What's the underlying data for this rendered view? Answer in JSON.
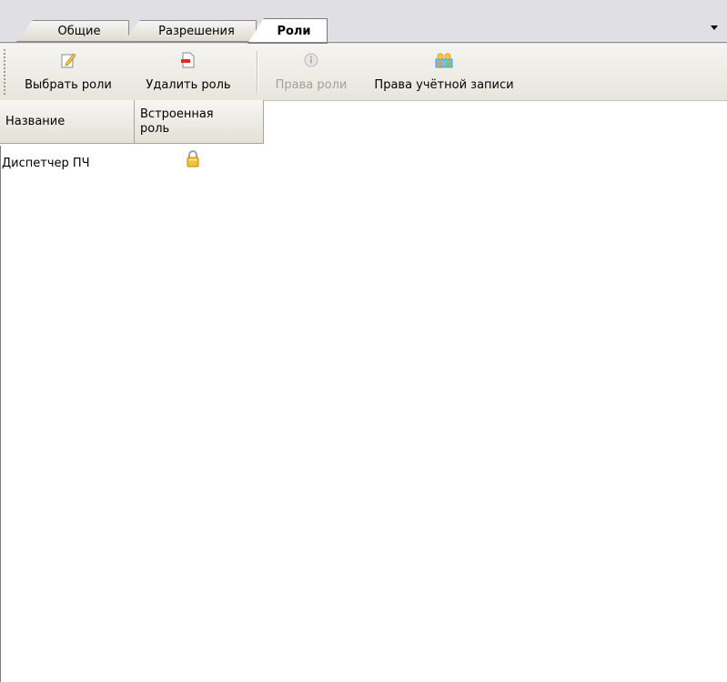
{
  "tabs": [
    {
      "label": "Общие",
      "active": false
    },
    {
      "label": "Разрешения",
      "active": false
    },
    {
      "label": "Роли",
      "active": true
    }
  ],
  "toolbar": {
    "select_roles": "Выбрать роли",
    "delete_role": "Удалить роль",
    "role_rights": "Права роли",
    "account_rights": "Права учётной записи"
  },
  "list": {
    "columns": [
      "Название",
      "Встроенная роль"
    ],
    "rows": [
      {
        "name": "Диспетчер ПЧ",
        "builtin_icon": "lock-icon"
      }
    ]
  },
  "colors": {
    "tab_strip": "#e0dfe3",
    "disabled_text": "#a0a0a0"
  }
}
